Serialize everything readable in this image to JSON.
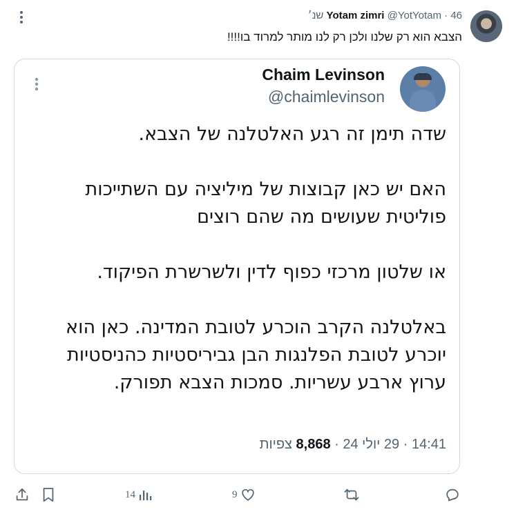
{
  "outer_tweet": {
    "author_name": "Yotam zimri",
    "handle": "@YotYotam",
    "separator": "·",
    "time": "46 שנ׳",
    "text": "הצבא הוא רק שלנו ולכן רק לנו מותר למרוד בו!!!!"
  },
  "quoted_tweet": {
    "author_name": "Chaim Levinson",
    "handle": "@chaimlevinson",
    "paragraphs": [
      [
        "שדה תימן זה רגע האלטלנה של הצבא."
      ],
      [
        "האם יש כאן קבוצות של מיליציה עם השתייכות",
        "פוליטית שעושים מה שהם רוצים"
      ],
      [
        "או שלטון מרכזי כפוף לדין ולשרשרת הפיקוד."
      ],
      [
        "באלטלנה הקרב הוכרע לטובת המדינה. כאן הוא",
        "יוכרע לטובת הפלנגות הבן גביריסטיות כהניסטיות",
        "ערוץ ארבע עשריות. סמכות הצבא תפורק."
      ]
    ],
    "meta": {
      "time": "14:41",
      "date": "29 יולי 24",
      "views_count": "8,868",
      "views_label": "צפיות"
    }
  },
  "actions": {
    "replies_icon": "reply-icon",
    "retweets_icon": "retweet-icon",
    "likes_count": "9",
    "views_count": "14",
    "bookmark_icon": "bookmark-icon",
    "share_icon": "share-icon"
  },
  "colors": {
    "text": "#0f1419",
    "secondary": "#536471",
    "border": "#cfd9de"
  }
}
